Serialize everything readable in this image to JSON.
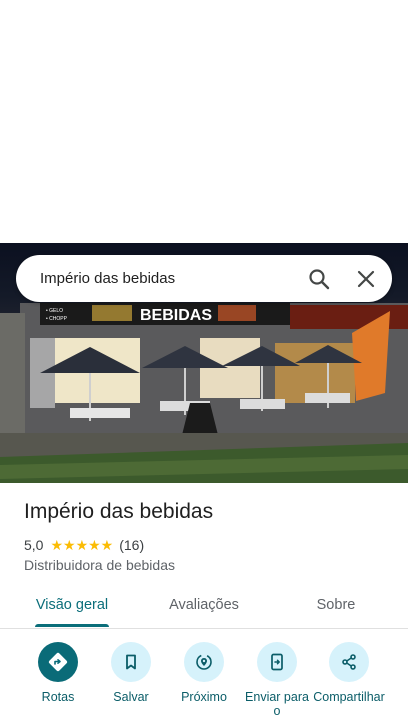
{
  "search": {
    "query": "Império das bebidas"
  },
  "photo": {
    "sign_text": "BEBIDAS",
    "sign_small_1": "• GELO",
    "sign_small_2": "• CHOPP"
  },
  "place": {
    "name": "Império das bebidas",
    "rating": "5,0",
    "stars": "★★★★★",
    "review_count": "(16)",
    "category": "Distribuidora de bebidas"
  },
  "tabs": [
    {
      "label": "Visão geral",
      "active": true
    },
    {
      "label": "Avaliações",
      "active": false
    },
    {
      "label": "Sobre",
      "active": false
    }
  ],
  "actions": [
    {
      "label": "Rotas",
      "icon": "directions-icon"
    },
    {
      "label": "Salvar",
      "icon": "bookmark-icon"
    },
    {
      "label": "Próximo",
      "icon": "nearby-icon"
    },
    {
      "label": "Enviar para o",
      "icon": "send-to-phone-icon"
    },
    {
      "label": "Compartilhar",
      "icon": "share-icon"
    }
  ],
  "colors": {
    "accent": "#0a6b78",
    "action_bg": "#d6f2fb",
    "star": "#fbbc04"
  }
}
